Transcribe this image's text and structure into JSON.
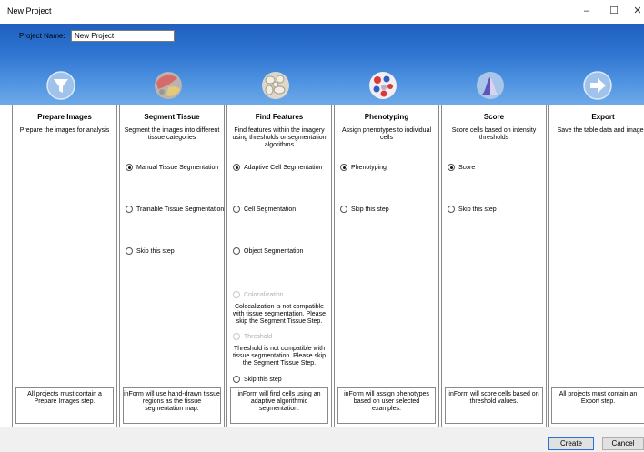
{
  "window": {
    "title": "New Project",
    "minimize_glyph": "–",
    "maximize_glyph": "☐",
    "close_glyph": "✕"
  },
  "project": {
    "name_label": "Project Name:",
    "name_value": "New Project"
  },
  "steps": [
    {
      "title": "Prepare Images",
      "description": "Prepare the images for analysis",
      "icon": "funnel-icon",
      "options": [],
      "footer": "All projects must contain a Prepare Images step."
    },
    {
      "title": "Segment Tissue",
      "description": "Segment the images into different tissue categories",
      "icon": "tissue-icon",
      "options": [
        {
          "label": "Manual Tissue Segmentation",
          "selected": true
        },
        {
          "label": "Trainable Tissue Segmentation",
          "selected": false
        },
        {
          "label": "Skip this step",
          "selected": false
        }
      ],
      "footer": "inForm will use hand-drawn tissue regions as the tissue segmentation map."
    },
    {
      "title": "Find Features",
      "description": "Find features within the imagery using thresholds or segmentation algorithms",
      "icon": "cells-icon",
      "options": [
        {
          "label": "Adaptive Cell Segmentation",
          "selected": true
        },
        {
          "label": "Cell Segmentation",
          "selected": false
        },
        {
          "label": "Object Segmentation",
          "selected": false
        },
        {
          "label": "Colocalization",
          "selected": false,
          "disabled": true
        },
        {
          "label": "Threshold",
          "selected": false,
          "disabled": true
        },
        {
          "label": "Skip this step",
          "selected": false
        }
      ],
      "notes": [
        "Colocalization is not compatible with tissue segmentation. Please skip the Segment Tissue Step.",
        "Threshold is not compatible with tissue segmentation. Please skip the Segment Tissue Step."
      ],
      "footer": "inForm will find cells using an adaptive algorithmic segmentation."
    },
    {
      "title": "Phenotyping",
      "description": "Assign phenotypes to individual cells",
      "icon": "phenotype-icon",
      "options": [
        {
          "label": "Phenotyping",
          "selected": true
        },
        {
          "label": "Skip this step",
          "selected": false
        }
      ],
      "footer": "inForm will assign phenotypes based on user selected examples."
    },
    {
      "title": "Score",
      "description": "Score cells based on intensity thresholds",
      "icon": "score-icon",
      "options": [
        {
          "label": "Score",
          "selected": true
        },
        {
          "label": "Skip this step",
          "selected": false
        }
      ],
      "footer": "inForm will score cells based on threshold values."
    },
    {
      "title": "Export",
      "description": "Save the table data and imagery",
      "icon": "export-arrow-icon",
      "options": [],
      "footer": "All projects must contain an Export step."
    }
  ],
  "buttons": {
    "create": "Create",
    "cancel": "Cancel"
  },
  "colors": {
    "header_top": "#1f5fbf",
    "header_bottom": "#6faae8"
  }
}
